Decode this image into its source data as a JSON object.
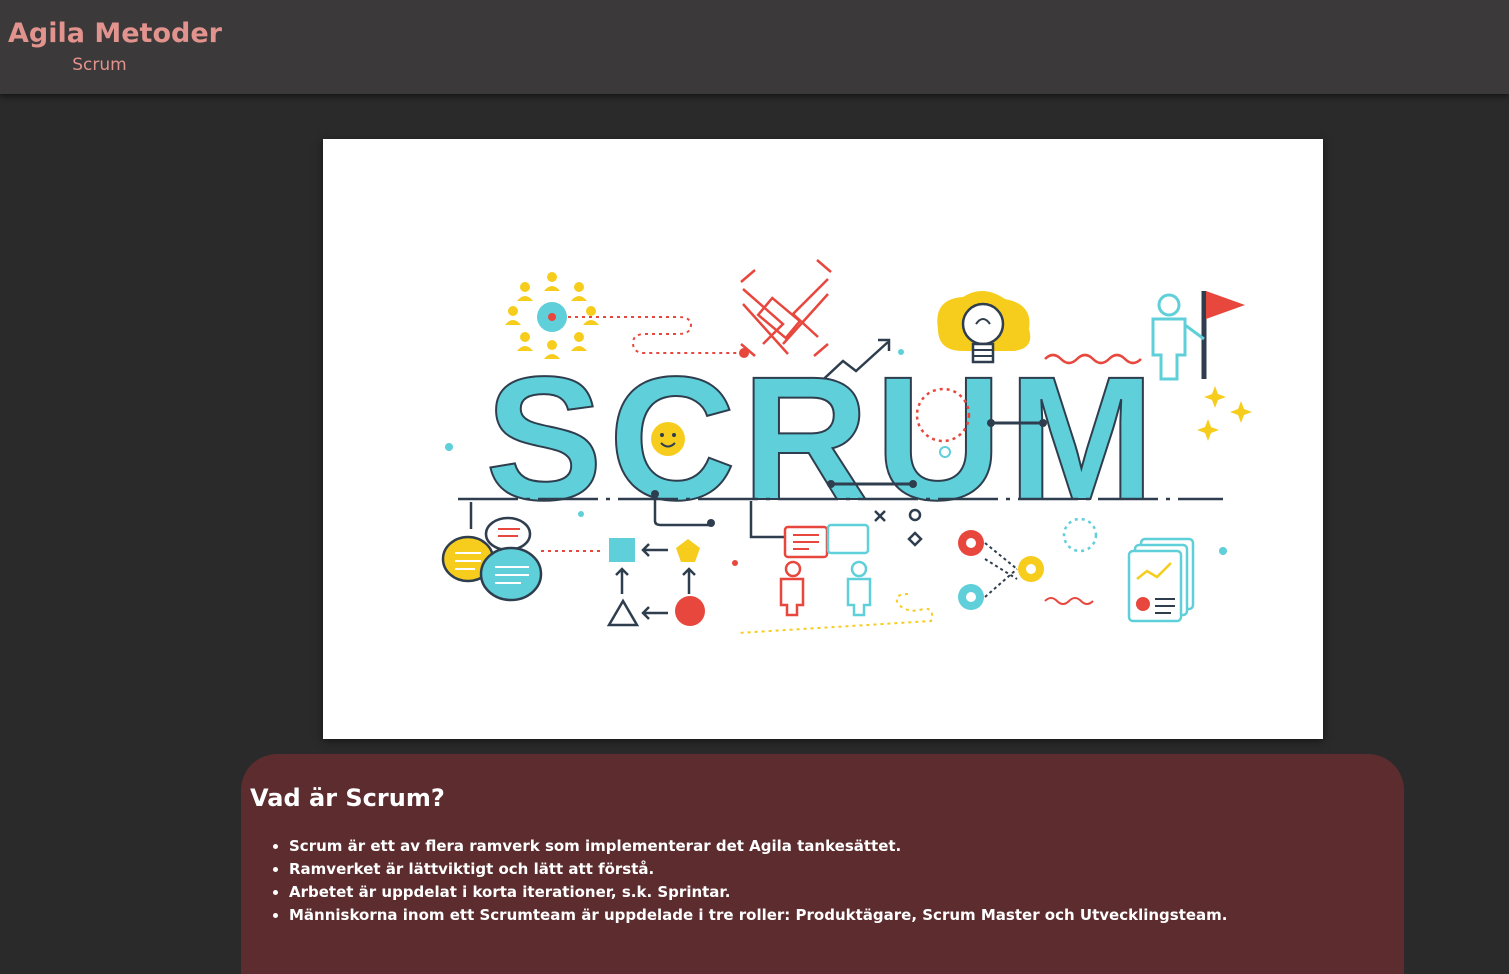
{
  "header": {
    "title": "Agila Metoder",
    "subtitle": "Scrum"
  },
  "hero": {
    "word": "SCRUM",
    "colors": {
      "teal": "#5fcfd9",
      "red": "#e8473d",
      "yellow": "#f7cd1d",
      "navy": "#2f3e4e"
    },
    "icons": [
      "team-icon",
      "handshake-icon",
      "lightbulb-icon",
      "flag-icon",
      "chat-icon",
      "workflow-icon",
      "presenter-icon",
      "gears-icon",
      "report-icon"
    ]
  },
  "content": {
    "heading": "Vad är Scrum?",
    "items": [
      "Scrum är ett av flera ramverk som implementerar det Agila tankesättet.",
      "Ramverket är lättviktigt och lätt att förstå.",
      "Arbetet är uppdelat i korta iterationer, s.k. Sprintar.",
      "Människorna inom ett Scrumteam är uppdelade i tre roller: Produktägare, Scrum Master och Utvecklingsteam."
    ]
  }
}
